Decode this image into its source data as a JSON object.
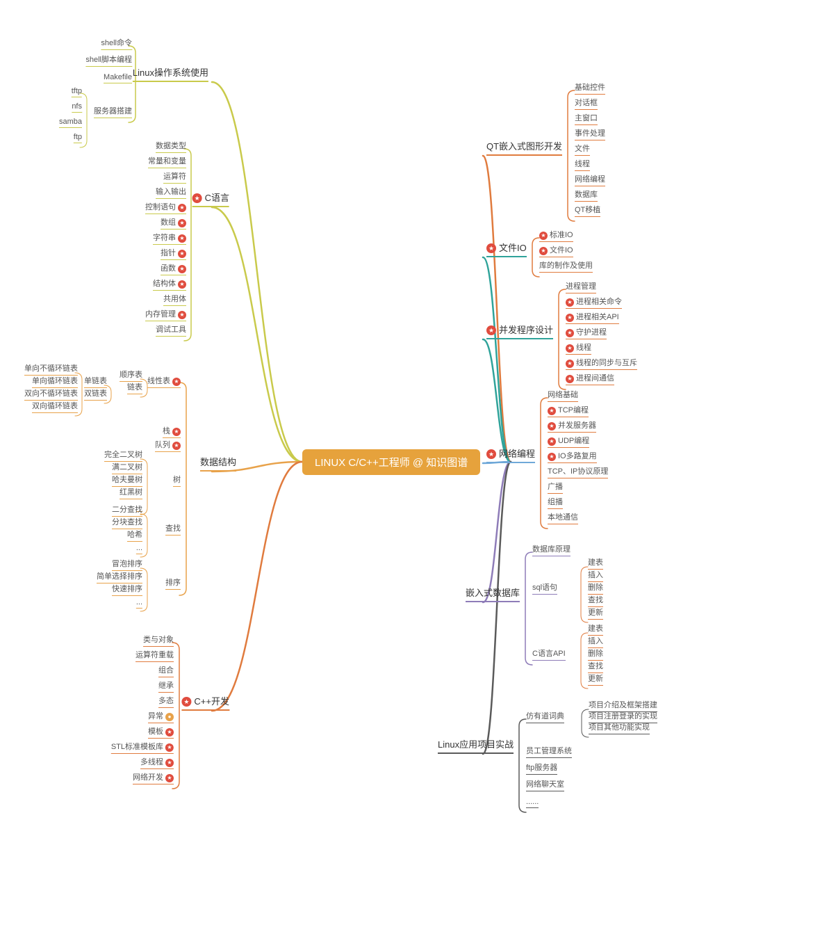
{
  "center": {
    "label": "LINUX C/C++工程师 @ 知识图谱"
  },
  "leftBranches": [
    {
      "label": "Linux操作系统使用",
      "star": false,
      "color": "#C9CA4B",
      "leaves": [
        {
          "label": "shell命令"
        },
        {
          "label": "shell脚本编程"
        },
        {
          "label": "Makefile"
        },
        {
          "label": "服务器搭建",
          "sub": [
            "tftp",
            "nfs",
            "samba",
            "ftp"
          ]
        }
      ]
    },
    {
      "label": "C语言",
      "star": true,
      "color": "#C9CA4B",
      "leaves": [
        {
          "label": "数据类型"
        },
        {
          "label": "常量和变量"
        },
        {
          "label": "运算符"
        },
        {
          "label": "输入输出"
        },
        {
          "label": "控制语句",
          "star": true
        },
        {
          "label": "数组",
          "star": true
        },
        {
          "label": "字符串",
          "star": true
        },
        {
          "label": "指针",
          "star": true
        },
        {
          "label": "函数",
          "star": true
        },
        {
          "label": "结构体",
          "star": true
        },
        {
          "label": "共用体"
        },
        {
          "label": "内存管理",
          "star": true
        },
        {
          "label": "调试工具"
        }
      ]
    },
    {
      "label": "数据结构",
      "star": false,
      "color": "#E8A24A",
      "groups": [
        {
          "label": "线性表",
          "star": true,
          "leaves": [
            {
              "label": "顺序表"
            },
            {
              "label": "链表",
              "sub": [
                "单链表",
                "双链表"
              ],
              "deep": [
                "单向不循环链表",
                "单向循环链表",
                "双向不循环链表",
                "双向循环链表"
              ]
            }
          ]
        },
        {
          "label": "栈",
          "star": true
        },
        {
          "label": "队列",
          "star": true
        },
        {
          "label": "树",
          "leaves": [
            {
              "label": "完全二叉树"
            },
            {
              "label": "满二叉树"
            },
            {
              "label": "哈夫曼树"
            },
            {
              "label": "红黑树"
            },
            {
              "label": "..."
            }
          ]
        },
        {
          "label": "查找",
          "leaves": [
            {
              "label": "二分查找"
            },
            {
              "label": "分块查找"
            },
            {
              "label": "哈希"
            },
            {
              "label": "..."
            }
          ]
        },
        {
          "label": "排序",
          "leaves": [
            {
              "label": "冒泡排序"
            },
            {
              "label": "简单选择排序"
            },
            {
              "label": "快速排序"
            },
            {
              "label": "..."
            }
          ]
        }
      ]
    },
    {
      "label": "C++开发",
      "star": true,
      "color": "#E07B3E",
      "leaves": [
        {
          "label": "类与对象"
        },
        {
          "label": "运算符重载"
        },
        {
          "label": "组合"
        },
        {
          "label": "继承"
        },
        {
          "label": "多态"
        },
        {
          "label": "异常",
          "dot": true
        },
        {
          "label": "模板",
          "star": true
        },
        {
          "label": "STL标准模板库",
          "star": true
        },
        {
          "label": "多线程",
          "star": true
        },
        {
          "label": "网络开发",
          "star": true
        }
      ]
    }
  ],
  "rightBranches": [
    {
      "label": "QT嵌入式图形开发",
      "star": false,
      "color": "#E07B3E",
      "leaves": [
        {
          "label": "基础控件"
        },
        {
          "label": "对话框"
        },
        {
          "label": "主窗口"
        },
        {
          "label": "事件处理"
        },
        {
          "label": "文件"
        },
        {
          "label": "线程"
        },
        {
          "label": "网络编程"
        },
        {
          "label": "数据库"
        },
        {
          "label": "QT移植"
        }
      ]
    },
    {
      "label": "文件IO",
      "star": true,
      "color": "#2FA39A",
      "leaves": [
        {
          "label": "标准IO",
          "star": true
        },
        {
          "label": "文件IO",
          "star": true
        },
        {
          "label": "库的制作及使用"
        }
      ]
    },
    {
      "label": "并发程序设计",
      "star": true,
      "color": "#2FA39A",
      "leaves": [
        {
          "label": "进程管理"
        },
        {
          "label": "进程相关命令",
          "star": true
        },
        {
          "label": "进程相关API",
          "star": true
        },
        {
          "label": "守护进程",
          "star": true
        },
        {
          "label": "线程",
          "star": true
        },
        {
          "label": "线程的同步与互斥",
          "star": true
        },
        {
          "label": "进程间通信",
          "star": true
        }
      ]
    },
    {
      "label": "网络编程",
      "star": true,
      "color": "#6FA8D8",
      "leaves": [
        {
          "label": "网络基础"
        },
        {
          "label": "TCP编程",
          "star": true
        },
        {
          "label": "并发服务器",
          "star": true
        },
        {
          "label": "UDP编程",
          "star": true
        },
        {
          "label": "IO多路复用",
          "star": true
        },
        {
          "label": "TCP、IP协议原理"
        },
        {
          "label": "广播"
        },
        {
          "label": "组播"
        },
        {
          "label": "本地通信"
        }
      ]
    },
    {
      "label": "嵌入式数据库",
      "star": false,
      "color": "#8E7CB8",
      "groups": [
        {
          "label": "数据库原理"
        },
        {
          "label": "sql语句",
          "leaves": [
            {
              "label": "建表"
            },
            {
              "label": "插入"
            },
            {
              "label": "删除"
            },
            {
              "label": "查找"
            },
            {
              "label": "更新"
            }
          ]
        },
        {
          "label": "C语言API",
          "leaves": [
            {
              "label": "建表"
            },
            {
              "label": "插入"
            },
            {
              "label": "删除"
            },
            {
              "label": "查找"
            },
            {
              "label": "更新"
            }
          ]
        }
      ]
    },
    {
      "label": "Linux应用项目实战",
      "star": false,
      "color": "#5A5A5A",
      "groups": [
        {
          "label": "仿有道词典",
          "leaves": [
            {
              "label": "项目介绍及框架搭建"
            },
            {
              "label": "项目注册登录的实现"
            },
            {
              "label": "项目其他功能实现"
            }
          ]
        },
        {
          "label": "员工管理系统"
        },
        {
          "label": "ftp服务器"
        },
        {
          "label": "网络聊天室"
        },
        {
          "label": "......"
        }
      ]
    }
  ]
}
